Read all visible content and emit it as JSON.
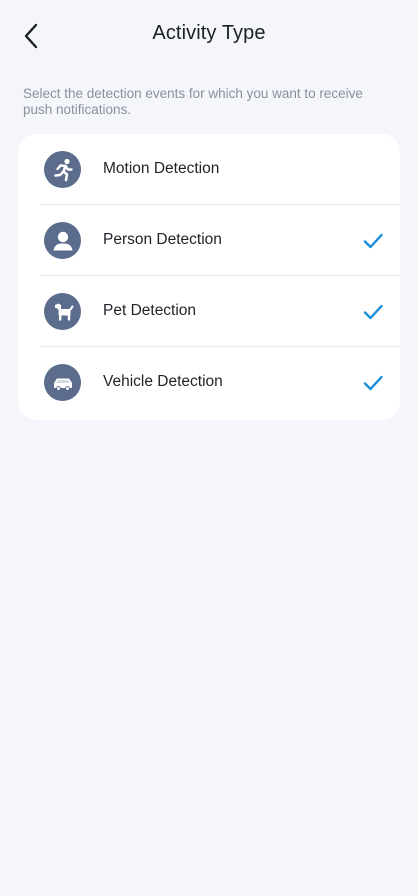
{
  "header": {
    "title": "Activity Type",
    "back_icon": "chevron-left-icon"
  },
  "description": "Select the detection events for which you want to receive push notifications.",
  "colors": {
    "accent": "#1a8fd8",
    "icon_bg": "#5b6c8c",
    "background": "#f4f6fb"
  },
  "items": [
    {
      "label": "Motion Detection",
      "icon": "running-person-icon",
      "checked": false
    },
    {
      "label": "Person Detection",
      "icon": "person-icon",
      "checked": true
    },
    {
      "label": "Pet Detection",
      "icon": "dog-icon",
      "checked": true
    },
    {
      "label": "Vehicle Detection",
      "icon": "car-icon",
      "checked": true
    }
  ]
}
